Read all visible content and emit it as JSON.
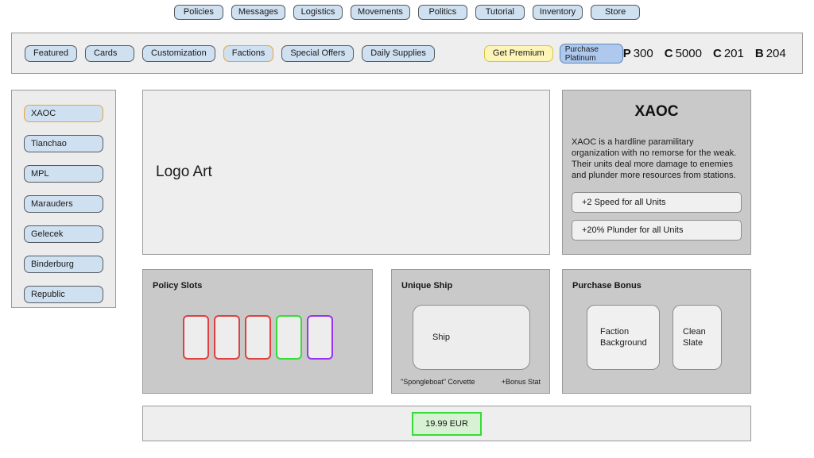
{
  "top_nav": {
    "items": [
      {
        "label": "Policies"
      },
      {
        "label": "Messages"
      },
      {
        "label": "Logistics"
      },
      {
        "label": "Movements"
      },
      {
        "label": "Politics"
      },
      {
        "label": "Tutorial"
      },
      {
        "label": "Inventory"
      },
      {
        "label": "Store"
      }
    ]
  },
  "store_toolbar": {
    "tabs": [
      {
        "label": "Featured",
        "active": false
      },
      {
        "label": "Cards",
        "active": false
      },
      {
        "label": "Customization",
        "active": false
      },
      {
        "label": "Factions",
        "active": true
      },
      {
        "label": "Special Offers",
        "active": false
      },
      {
        "label": "Daily Supplies",
        "active": false
      }
    ],
    "get_premium_label": "Get Premium",
    "purchase_platinum_line1": "Purchase",
    "purchase_platinum_line2": "Platinum",
    "currencies": [
      {
        "symbol": "P",
        "amount": "300"
      },
      {
        "symbol": "C",
        "amount": "5000"
      },
      {
        "symbol": "C",
        "amount": "201"
      },
      {
        "symbol": "B",
        "amount": "204"
      }
    ]
  },
  "sidebar": {
    "items": [
      {
        "label": "XAOC",
        "active": true
      },
      {
        "label": "Tianchao",
        "active": false
      },
      {
        "label": "MPL",
        "active": false
      },
      {
        "label": "Marauders",
        "active": false
      },
      {
        "label": "Gelecek",
        "active": false
      },
      {
        "label": "Binderburg",
        "active": false
      },
      {
        "label": "Republic",
        "active": false
      }
    ]
  },
  "logo_panel": {
    "placeholder_text": "Logo Art"
  },
  "faction_info": {
    "title": "XAOC",
    "description": "XAOC is a hardline paramilitary organization with no remorse for the weak. Their units deal more damage to enemies and plunder more resources from stations.",
    "perks": [
      {
        "label": "+2 Speed for all Units"
      },
      {
        "label": "+20% Plunder for all Units"
      }
    ]
  },
  "policy_panel": {
    "title": "Policy Slots",
    "slots": [
      {
        "color": "#e04040"
      },
      {
        "color": "#e04040"
      },
      {
        "color": "#e04040"
      },
      {
        "color": "#33dd33"
      },
      {
        "color": "#9933ee"
      }
    ]
  },
  "ship_panel": {
    "title": "Unique Ship",
    "art_placeholder": "Ship",
    "ship_name": "\"Spongleboat\" Corvette",
    "bonus_stat": "+Bonus Stat"
  },
  "bonus_panel": {
    "title": "Purchase Bonus",
    "cards": [
      {
        "line1": "Faction",
        "line2": "Background",
        "size": "wide"
      },
      {
        "line1": "Clean",
        "line2": "Slate",
        "size": "narrow"
      }
    ]
  },
  "price_bar": {
    "price_label": "19.99 EUR"
  },
  "colors": {
    "button_fill": "#cfe0f0",
    "active_border": "#e8a33d",
    "premium_fill": "#fdf4b8",
    "platinum_fill": "#aec9ed",
    "panel_gray": "#c9c9c9",
    "panel_light": "#eeeeee",
    "price_green": "#33dd33"
  }
}
